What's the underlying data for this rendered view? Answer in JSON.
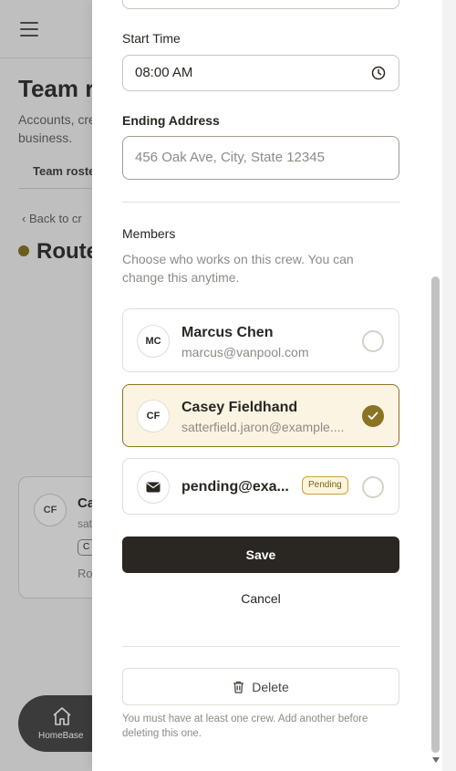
{
  "background": {
    "page_title": "Team ro",
    "subtitle": "Accounts, cre business.",
    "tab": "Team roste",
    "back_link": "Back to cr",
    "route_title": "Route",
    "card": {
      "initials": "CF",
      "name": "Ca",
      "email": "sat",
      "chip": "C",
      "route": "Ro"
    },
    "home_nav_label": "HomeBase"
  },
  "drawer": {
    "start_time": {
      "label": "Start Time",
      "value": "08:00 AM"
    },
    "ending_address": {
      "label": "Ending Address",
      "placeholder": "456 Oak Ave, City, State 12345"
    },
    "members": {
      "label": "Members",
      "help": "Choose who works on this crew. You can change this anytime.",
      "items": [
        {
          "initials": "MC",
          "name": "Marcus Chen",
          "email": "marcus@vanpool.com",
          "selected": false
        },
        {
          "initials": "CF",
          "name": "Casey Fieldhand",
          "email": "satterfield.jaron@example....",
          "selected": true
        },
        {
          "initials": "",
          "name": "pending@exa...",
          "email": "",
          "badge": "Pending",
          "selected": false
        }
      ]
    },
    "save_label": "Save",
    "cancel_label": "Cancel",
    "delete_label": "Delete",
    "delete_note": "You must have at least one crew. Add another before deleting this one."
  },
  "colors": {
    "accent": "#8a7324",
    "primary_button": "#2a2622",
    "selected_bg": "#fbf4e3"
  }
}
